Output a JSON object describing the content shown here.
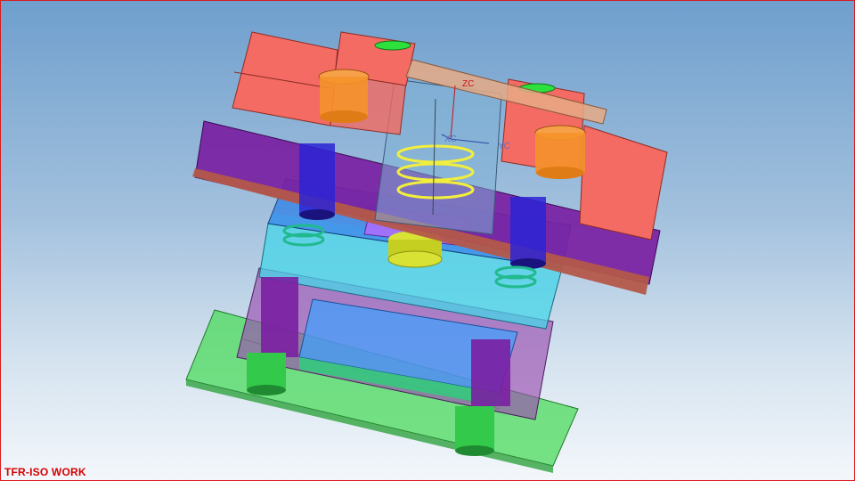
{
  "viewport": {
    "view_label": "TFR-ISO WORK",
    "background_top": "#6f9fcd",
    "background_bottom": "#f3f7fb",
    "border_color": "#d81c1c"
  },
  "wcs": {
    "zc_label": "ZC",
    "xc_label": "XC",
    "yc_label": "YC"
  },
  "colors": {
    "clamp_block": "#f36b63",
    "top_plate": "#7a1fa2",
    "stripper_plate": "#2f7fe6",
    "cavity_plate": "#47d6e8",
    "support_plate": "#9b4fb0",
    "base_plate": "#4cdb5c",
    "guide_pillar": "#2b23d6",
    "bushing": "#f5922a",
    "punch": "#d8e235"
  }
}
